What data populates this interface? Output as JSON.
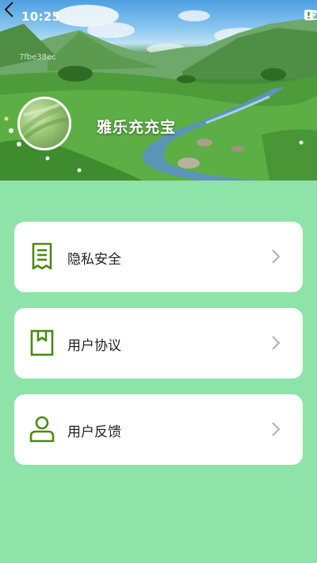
{
  "status_bar": {
    "time": "10:25",
    "icons": [
      "bluetooth-icon",
      "mute-icon",
      "wifi-icon",
      "alert-icon",
      "battery-icon"
    ]
  },
  "header": {
    "back_icon": "back-arrow-icon",
    "build_hash": "7fbe38ec",
    "app_name": "雅乐充充宝"
  },
  "menu": {
    "items": [
      {
        "label": "隐私安全",
        "icon": "document-icon"
      },
      {
        "label": "用户协议",
        "icon": "bookmark-book-icon"
      },
      {
        "label": "用户反馈",
        "icon": "user-icon"
      }
    ]
  },
  "colors": {
    "background": "#8ee3a9",
    "icon_green": "#4a8a12",
    "card": "#ffffff",
    "chevron": "#b5b5b5"
  }
}
